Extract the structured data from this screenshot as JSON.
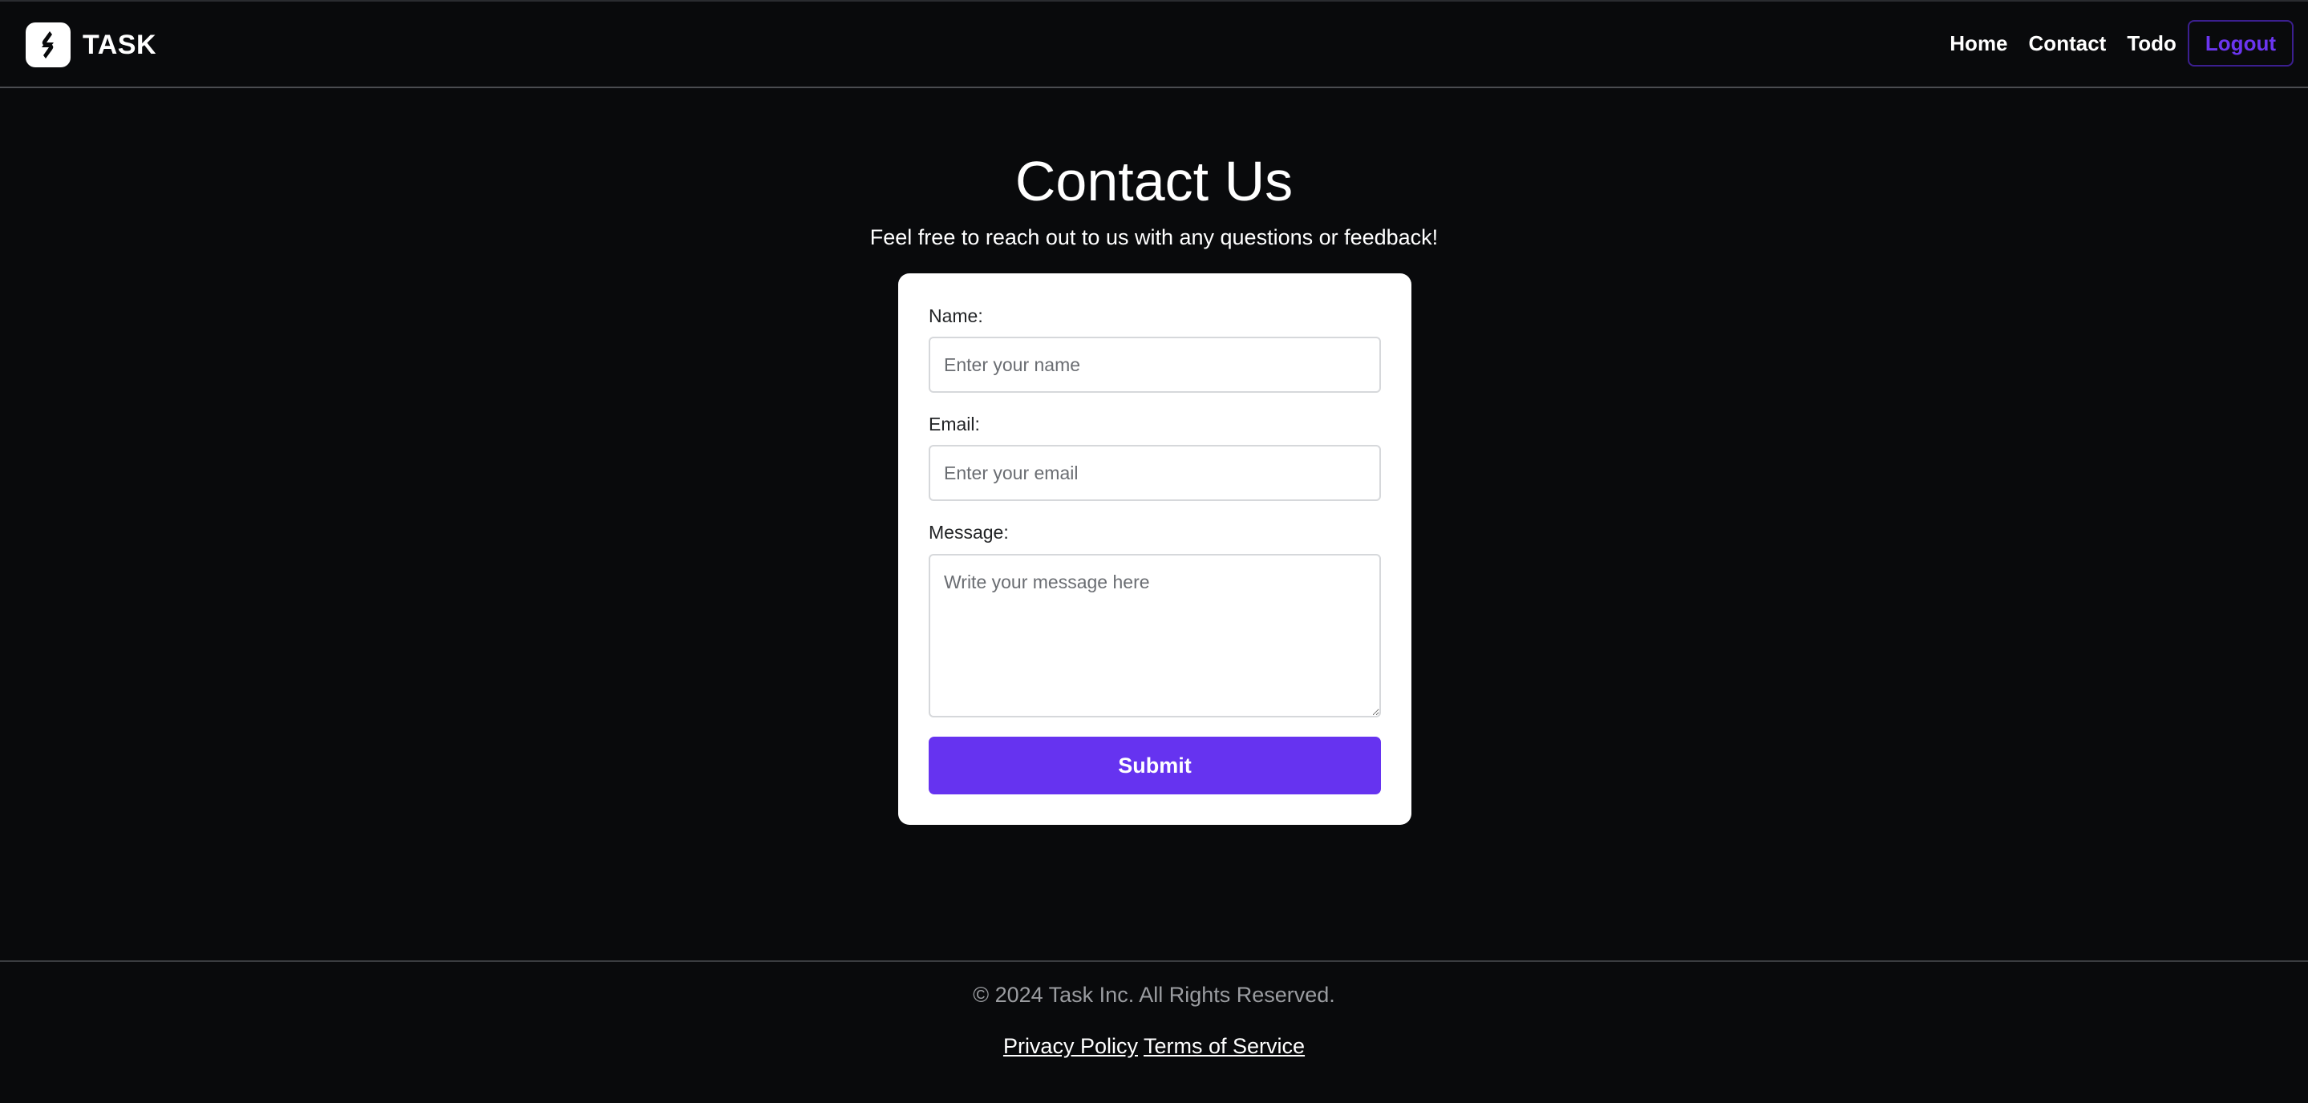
{
  "header": {
    "brand_name": "TASK",
    "logo_icon": "task-logo-icon",
    "nav": [
      {
        "label": "Home"
      },
      {
        "label": "Contact"
      },
      {
        "label": "Todo"
      }
    ],
    "logout_label": "Logout"
  },
  "main": {
    "title": "Contact Us",
    "subtitle": "Feel free to reach out to us with any questions or feedback!",
    "form": {
      "name_label": "Name:",
      "name_placeholder": "Enter your name",
      "name_value": "",
      "email_label": "Email:",
      "email_placeholder": "Enter your email",
      "email_value": "",
      "message_label": "Message:",
      "message_placeholder": "Write your message here",
      "message_value": "",
      "submit_label": "Submit"
    }
  },
  "footer": {
    "copyright": "© 2024 Task Inc. All Rights Reserved.",
    "links": [
      {
        "label": "Privacy Policy"
      },
      {
        "label": "Terms of Service"
      }
    ]
  },
  "colors": {
    "background": "#090a0c",
    "accent": "#6633f0",
    "card": "#ffffff",
    "muted_text": "#9a9ca0"
  }
}
